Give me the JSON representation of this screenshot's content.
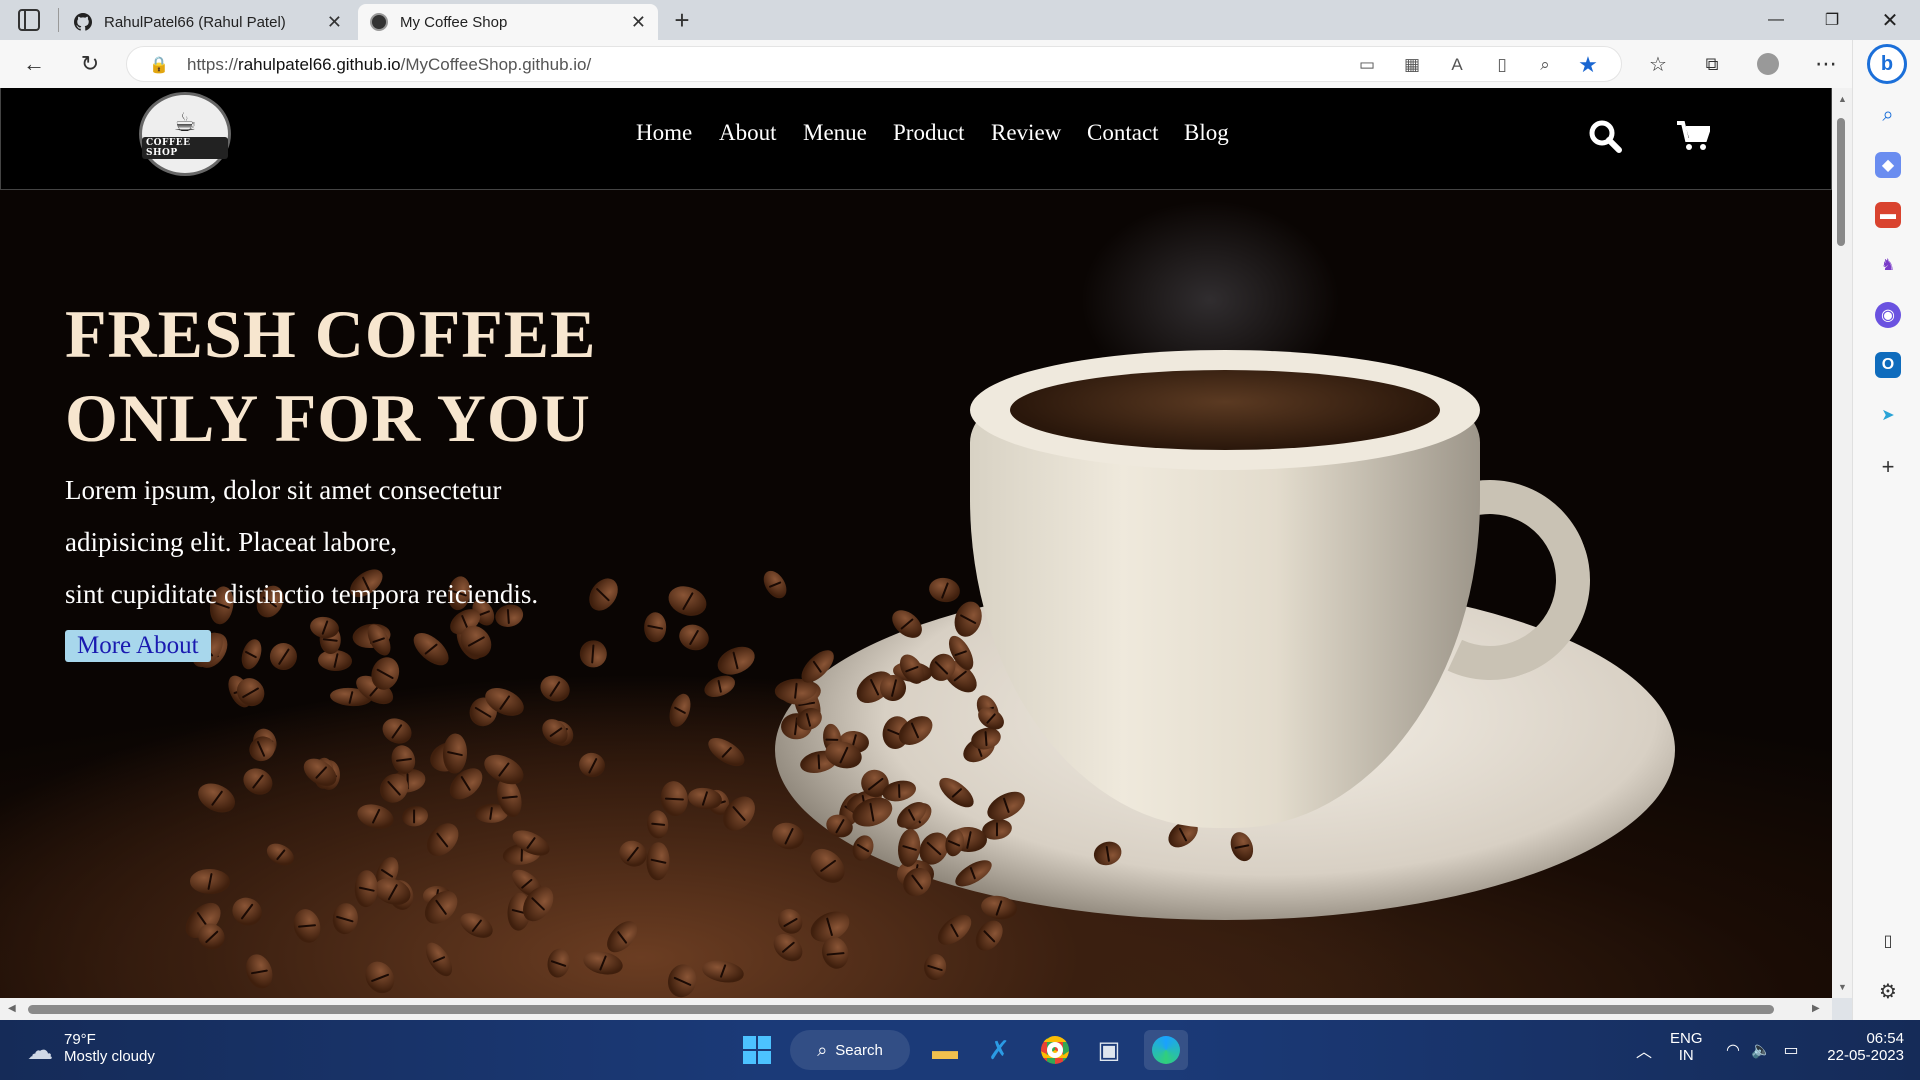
{
  "browser": {
    "tabs": [
      {
        "label": "RahulPatel66 (Rahul Patel)",
        "active": false,
        "icon": "github-icon"
      },
      {
        "label": "My Coffee Shop",
        "active": true,
        "icon": "coffee-shop-favicon"
      }
    ],
    "url_prefix": "https://",
    "url_host": "rahulpatel66.github.io",
    "url_path": "/MyCoffeeShop.github.io/"
  },
  "site": {
    "logo_text": "COFFEE SHOP",
    "nav": [
      "Home",
      "About",
      "Menue",
      "Product",
      "Review",
      "Contact",
      "Blog"
    ],
    "hero": {
      "title_line1": "FRESH COFFEE",
      "title_line2": "ONLY FOR YOU",
      "paragraph_lines": [
        "Lorem ipsum, dolor sit amet consectetur",
        "adipisicing elit. Placeat labore,",
        "sint cupiditate distinctio tempora reiciendis."
      ],
      "button_label": "More About"
    }
  },
  "taskbar": {
    "weather_temp": "79°F",
    "weather_desc": "Mostly cloudy",
    "search_label": "Search",
    "lang_line1": "ENG",
    "lang_line2": "IN",
    "time": "06:54",
    "date": "22-05-2023"
  },
  "colors": {
    "hero_title": "#f7e6cf",
    "button_bg": "#a8d7ec",
    "button_text": "#1a1ab0",
    "taskbar": "#1b3a78"
  }
}
